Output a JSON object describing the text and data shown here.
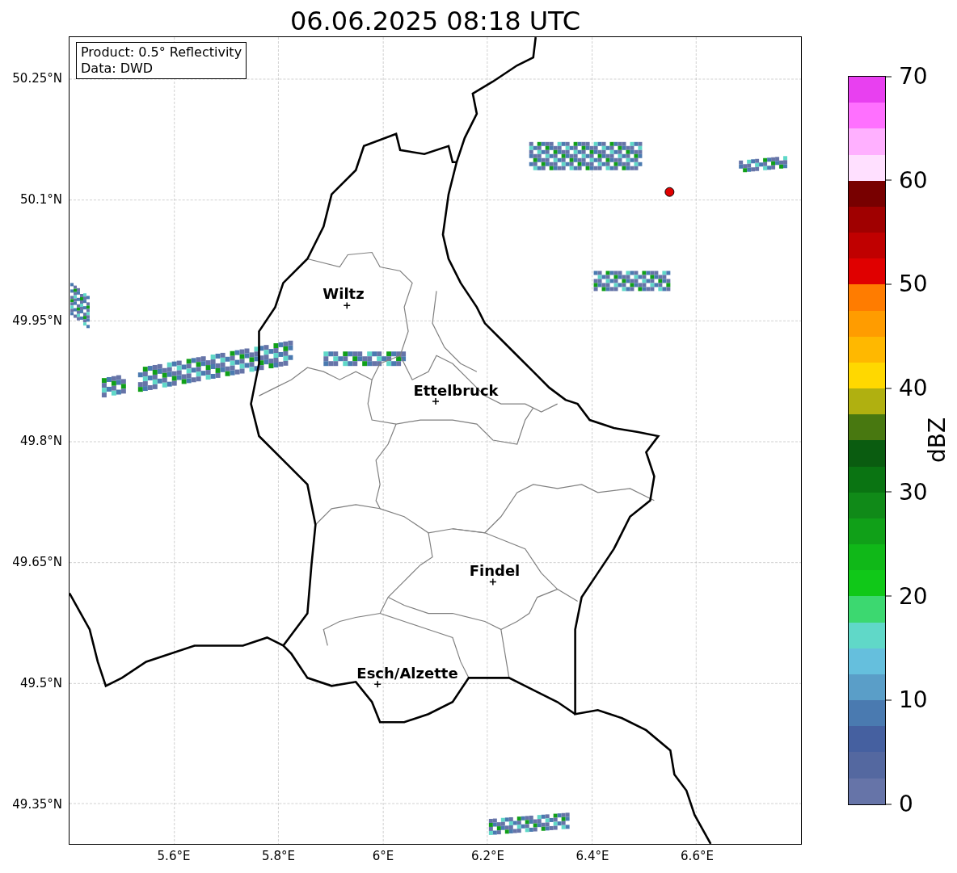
{
  "title": "06.06.2025 08:18 UTC",
  "info_box": [
    "Product: 0.5° Reflectivity",
    "Data: DWD"
  ],
  "cities": [
    {
      "name": "Wiltz"
    },
    {
      "name": "Ettelbruck"
    },
    {
      "name": "Findel"
    },
    {
      "name": "Esch/Alzette"
    }
  ],
  "x_ticks": [
    "5.6°E",
    "5.8°E",
    "6°E",
    "6.2°E",
    "6.4°E",
    "6.6°E"
  ],
  "y_ticks": [
    "50.25°N",
    "50.1°N",
    "49.95°N",
    "49.8°N",
    "49.65°N",
    "49.5°N",
    "49.35°N"
  ],
  "colorbar": {
    "label": "dBZ",
    "ticks": [
      "70",
      "60",
      "50",
      "40",
      "30",
      "20",
      "10",
      "0"
    ],
    "bins": [
      {
        "color": "#e840f0"
      },
      {
        "color": "#ff70ff"
      },
      {
        "color": "#ffb0ff"
      },
      {
        "color": "#ffe0ff"
      },
      {
        "color": "#780000"
      },
      {
        "color": "#a00000"
      },
      {
        "color": "#c00000"
      },
      {
        "color": "#e00000"
      },
      {
        "color": "#ff7c00"
      },
      {
        "color": "#ff9c00"
      },
      {
        "color": "#ffb800"
      },
      {
        "color": "#ffd800"
      },
      {
        "color": "#b0b010"
      },
      {
        "color": "#487810"
      },
      {
        "color": "#0a5c10"
      },
      {
        "color": "#0a7412"
      },
      {
        "color": "#108a18"
      },
      {
        "color": "#10a018"
      },
      {
        "color": "#10b818"
      },
      {
        "color": "#10c818"
      },
      {
        "color": "#3cd870"
      },
      {
        "color": "#60d8c8"
      },
      {
        "color": "#65bfdd"
      },
      {
        "color": "#5a9ec8"
      },
      {
        "color": "#4a7ab0"
      },
      {
        "color": "#4560a0"
      },
      {
        "color": "#5468a0"
      },
      {
        "color": "#6674a8"
      }
    ]
  }
}
